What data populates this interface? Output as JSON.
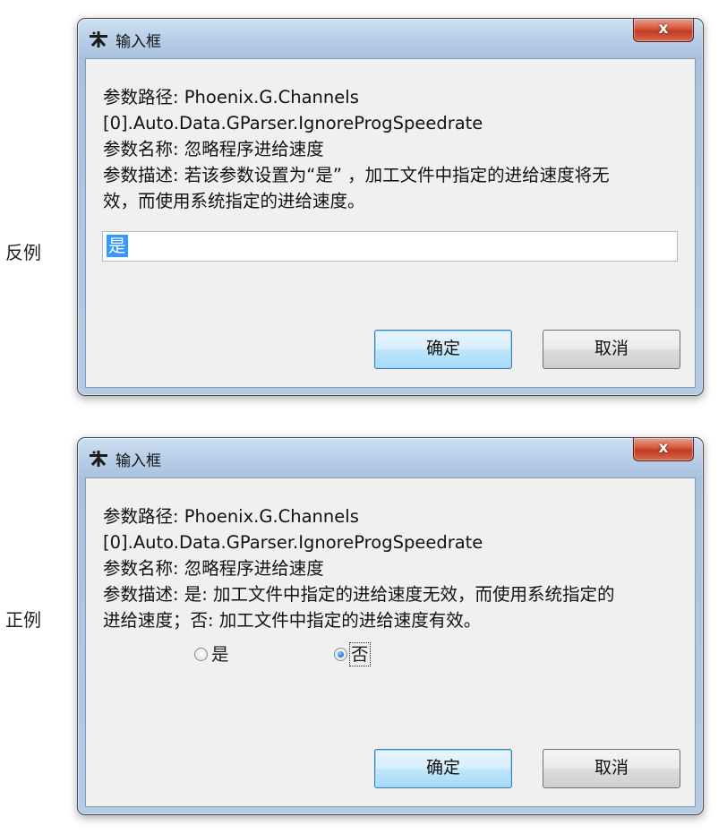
{
  "side_labels": {
    "bad": "反例",
    "good": "正例"
  },
  "dialog_bad": {
    "title": "输入框",
    "close_glyph": "x",
    "desc_lines": [
      "参数路径: Phoenix.G.Channels",
      "[0].Auto.Data.GParser.IgnoreProgSpeedrate",
      "参数名称: 忽略程序进给速度",
      "参数描述: 若该参数设置为“是” ，加工文件中指定的进给速度将无",
      "效，而使用系统指定的进给速度。"
    ],
    "input_value": "是",
    "ok_label": "确定",
    "cancel_label": "取消"
  },
  "dialog_good": {
    "title": "输入框",
    "close_glyph": "x",
    "desc_lines": [
      "参数路径: Phoenix.G.Channels",
      "[0].Auto.Data.GParser.IgnoreProgSpeedrate",
      "参数名称: 忽略程序进给速度",
      "参数描述: 是: 加工文件中指定的进给速度无效，而使用系统指定的",
      "进给速度；否: 加工文件中指定的进给速度有效。"
    ],
    "radio_yes": "是",
    "radio_no": "否",
    "selected": "否",
    "ok_label": "确定",
    "cancel_label": "取消"
  },
  "icons": {
    "app": "app-icon",
    "close": "close-icon",
    "radio": "radio-button-icon"
  },
  "colors": {
    "close_button": "#c74a2f",
    "default_button": "#bee6fd",
    "selection": "#3399ff"
  }
}
